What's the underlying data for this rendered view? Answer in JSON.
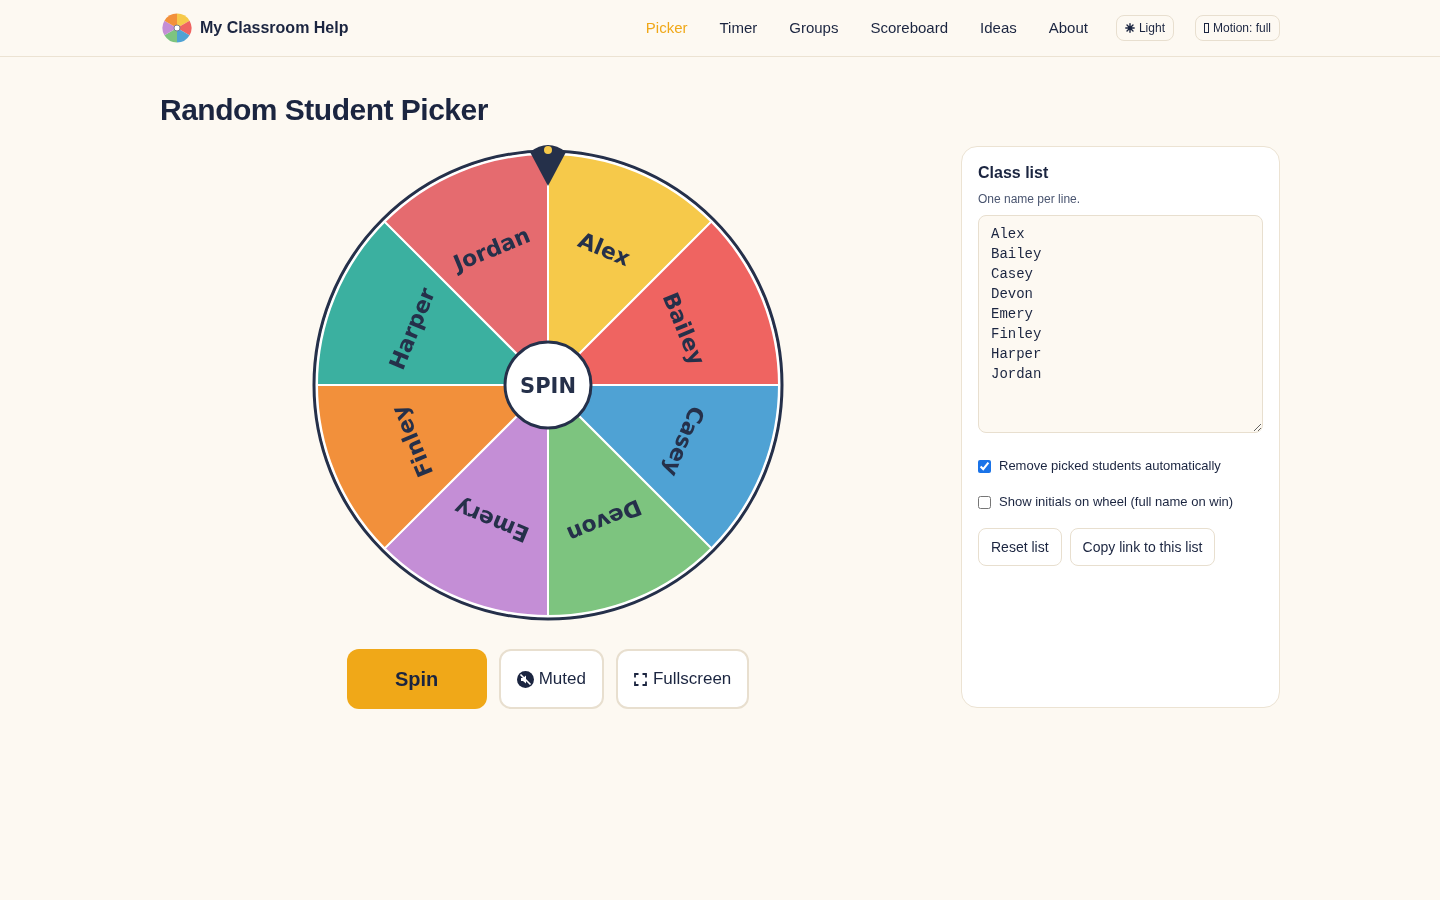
{
  "header": {
    "brand": "My Classroom Help",
    "nav": [
      {
        "label": "Picker",
        "selected": true
      },
      {
        "label": "Timer",
        "selected": false
      },
      {
        "label": "Groups",
        "selected": false
      },
      {
        "label": "Scoreboard",
        "selected": false
      },
      {
        "label": "Ideas",
        "selected": false
      },
      {
        "label": "About",
        "selected": false
      }
    ],
    "theme_button": {
      "label": "Light"
    },
    "motion_button": {
      "label": "Motion: full"
    }
  },
  "page_title": "Random Student Picker",
  "wheel": {
    "segments": [
      {
        "name": "Alex",
        "color": "#f6c94a"
      },
      {
        "name": "Bailey",
        "color": "#ef6461"
      },
      {
        "name": "Casey",
        "color": "#4fa2d4"
      },
      {
        "name": "Devon",
        "color": "#7dc47f"
      },
      {
        "name": "Emery",
        "color": "#c48ed6"
      },
      {
        "name": "Finley",
        "color": "#f2903b"
      },
      {
        "name": "Harper",
        "color": "#3bb0a0"
      },
      {
        "name": "Jordan",
        "color": "#e56b6f"
      }
    ],
    "center_label": "SPIN"
  },
  "controls": [
    {
      "kind": "primary",
      "label": "Spin"
    },
    {
      "kind": "sound",
      "label": "Muted"
    },
    {
      "kind": "fullscreen",
      "label": "Fullscreen"
    }
  ],
  "class_list": {
    "title": "Class list",
    "hint": "One name per line.",
    "value": "Alex\nBailey\nCasey\nDevon\nEmery\nFinley\nHarper\nJordan"
  },
  "options": [
    {
      "label": "Remove picked students automatically",
      "checked": true
    },
    {
      "label": "Show initials on wheel (full name on win)",
      "checked": false
    }
  ],
  "list_buttons": [
    "Reset list",
    "Copy link to this list"
  ]
}
